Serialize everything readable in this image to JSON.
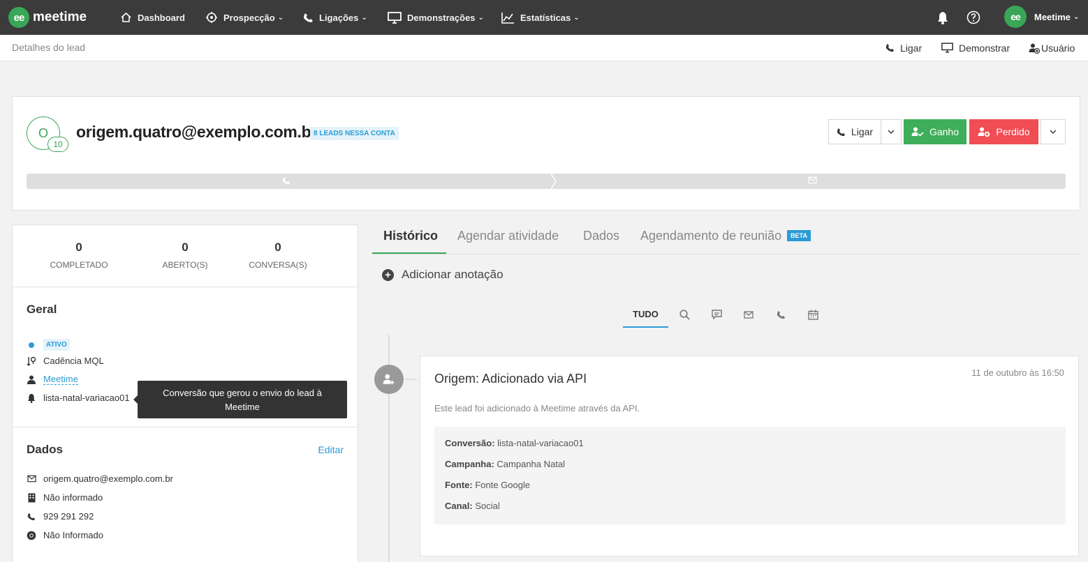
{
  "nav": {
    "logo_mark": "ee",
    "logo_text": "meetime",
    "items": [
      {
        "label": "Dashboard",
        "has_caret": false
      },
      {
        "label": "Prospecção",
        "has_caret": true
      },
      {
        "label": "Ligações",
        "has_caret": true
      },
      {
        "label": "Demonstrações",
        "has_caret": true
      },
      {
        "label": "Estatísticas",
        "has_caret": true
      }
    ],
    "user_avatar": "ee",
    "user_name": "Meetime",
    "caret": "⌄"
  },
  "subheader": {
    "breadcrumb": "Detalhes do lead",
    "actions": [
      "Ligar",
      "Demonstrar",
      "Usuário"
    ]
  },
  "lead": {
    "avatar_letter": "O",
    "score": "10",
    "email": "origem.quatro@exemplo.com.br",
    "leads_badge": "8 LEADS NESSA CONTA",
    "buttons": {
      "ligar": "Ligar",
      "ganho": "Ganho",
      "perdido": "Perdido"
    }
  },
  "stats": [
    {
      "value": "0",
      "label": "COMPLETADO"
    },
    {
      "value": "0",
      "label": "ABERTO(S)"
    },
    {
      "value": "0",
      "label": "CONVERSA(S)"
    }
  ],
  "geral": {
    "title": "Geral",
    "status": "ATIVO",
    "cadencia": "Cadência MQL",
    "owner": "Meetime",
    "conversion": "lista-natal-variacao01"
  },
  "tooltip": "Conversão que gerou o envio do lead à Meetime",
  "dados": {
    "title": "Dados",
    "edit": "Editar",
    "email": "origem.quatro@exemplo.com.br",
    "company": "Não informado",
    "phone": "929 291 292",
    "website": "Não Informado"
  },
  "tabs": [
    {
      "label": "Histórico",
      "active": true
    },
    {
      "label": "Agendar atividade",
      "active": false
    },
    {
      "label": "Dados",
      "active": false
    },
    {
      "label": "Agendamento de reunião",
      "active": false
    }
  ],
  "beta": "BETA",
  "add_note": "Adicionar anotação",
  "filter_all": "TUDO",
  "event": {
    "title": "Origem: Adicionado via API",
    "date": "11 de outubro às 16:50",
    "description": "Este lead foi adicionado à Meetime através da API.",
    "fields": [
      {
        "key": "Conversão:",
        "value": "lista-natal-variacao01"
      },
      {
        "key": "Campanha:",
        "value": "Campanha Natal"
      },
      {
        "key": "Fonte:",
        "value": "Fonte Google"
      },
      {
        "key": "Canal:",
        "value": "Social"
      }
    ]
  },
  "colors": {
    "brand_green": "#3aa657",
    "danger": "#f04d55",
    "accent_blue": "#2a9bd6",
    "nav_bg": "#3b3b3b"
  }
}
